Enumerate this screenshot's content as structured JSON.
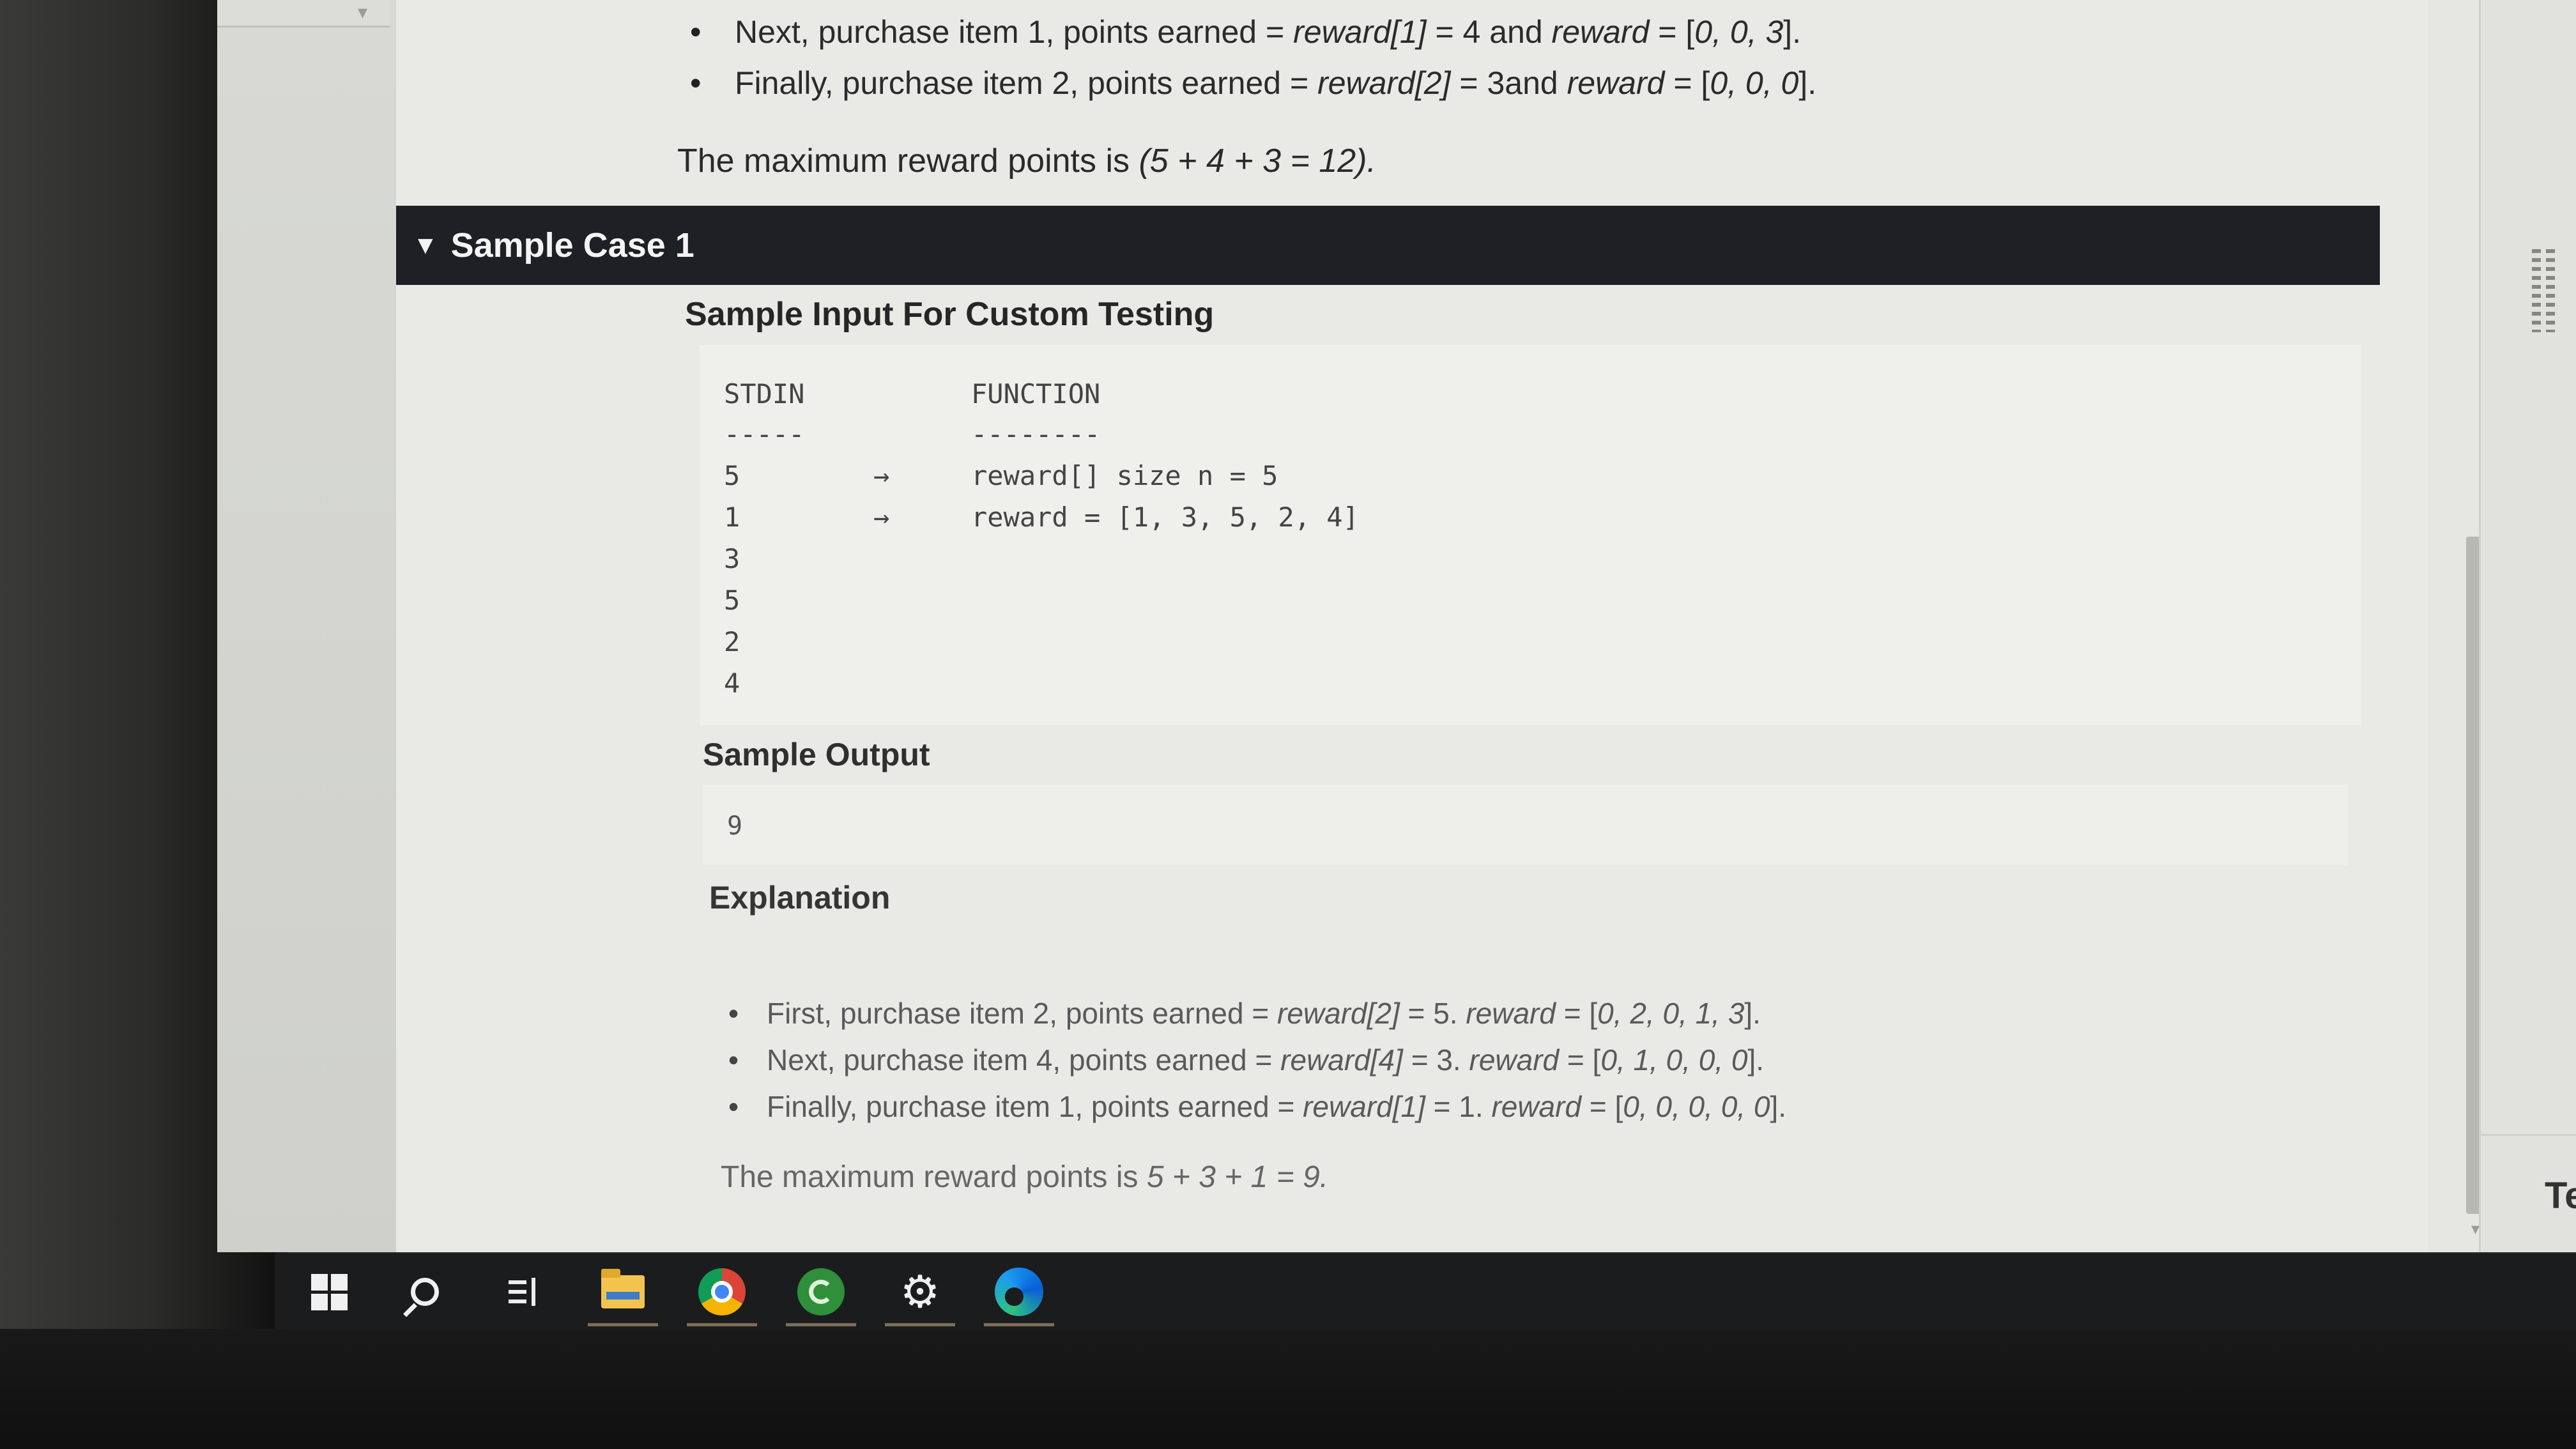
{
  "top_bullets": [
    {
      "pre": "Next, purchase item 1, points earned = ",
      "em1": "reward[1]",
      "mid": " = 4 and ",
      "em2": "reward",
      "post": " = [",
      "em3": "0, 0, 3",
      "end": "]."
    },
    {
      "pre": "Finally, purchase item 2, points earned = ",
      "em1": "reward[2]",
      "mid": " = 3and ",
      "em2": "reward",
      "post": " = [",
      "em3": "0, 0, 0",
      "end": "]."
    }
  ],
  "top_summary": {
    "text": "The maximum reward points is ",
    "em": "(5 + 4 + 3 = 12)."
  },
  "sample_case": {
    "title": "Sample Case 1"
  },
  "custom_testing_heading": "Sample Input For Custom Testing",
  "stdin_block": {
    "col1_header": "STDIN",
    "col1_rule": "-----",
    "col2_header": "FUNCTION",
    "col2_rule": "--------",
    "arrow": "→",
    "values": [
      "5",
      "1",
      "3",
      "5",
      "2",
      "4"
    ],
    "function_lines": [
      "reward[] size n = 5",
      "reward = [1, 3, 5, 2, 4]"
    ]
  },
  "sample_output": {
    "heading": "Sample Output",
    "value": "9"
  },
  "explanation": {
    "heading": "Explanation",
    "bullets": [
      {
        "pre": "First, purchase item 2, points earned = ",
        "em1": "reward[2]",
        "mid": " = 5.  ",
        "em2": "reward",
        "post": " = [",
        "em3": "0, 2, 0, 1, 3",
        "end": "]."
      },
      {
        "pre": "Next, purchase item 4, points earned = ",
        "em1": "reward[4]",
        "mid": " = 3. ",
        "em2": "reward",
        "post": " = [",
        "em3": "0, 1, 0, 0, 0",
        "end": "]."
      },
      {
        "pre": "Finally, purchase item 1, points earned = ",
        "em1": "reward[1]",
        "mid": " = 1. ",
        "em2": "reward",
        "post": " = [",
        "em3": "0, 0, 0, 0, 0",
        "end": "]."
      }
    ],
    "summary": {
      "text": "The maximum reward points is ",
      "em": "5 + 3 + 1 = 9."
    }
  },
  "right_edge_text": "Te",
  "taskbar": {
    "icons": [
      "windows-start-icon",
      "search-icon",
      "task-view-icon",
      "file-explorer-icon",
      "chrome-icon",
      "green-app-icon",
      "settings-gear-icon",
      "edge-icon"
    ]
  }
}
